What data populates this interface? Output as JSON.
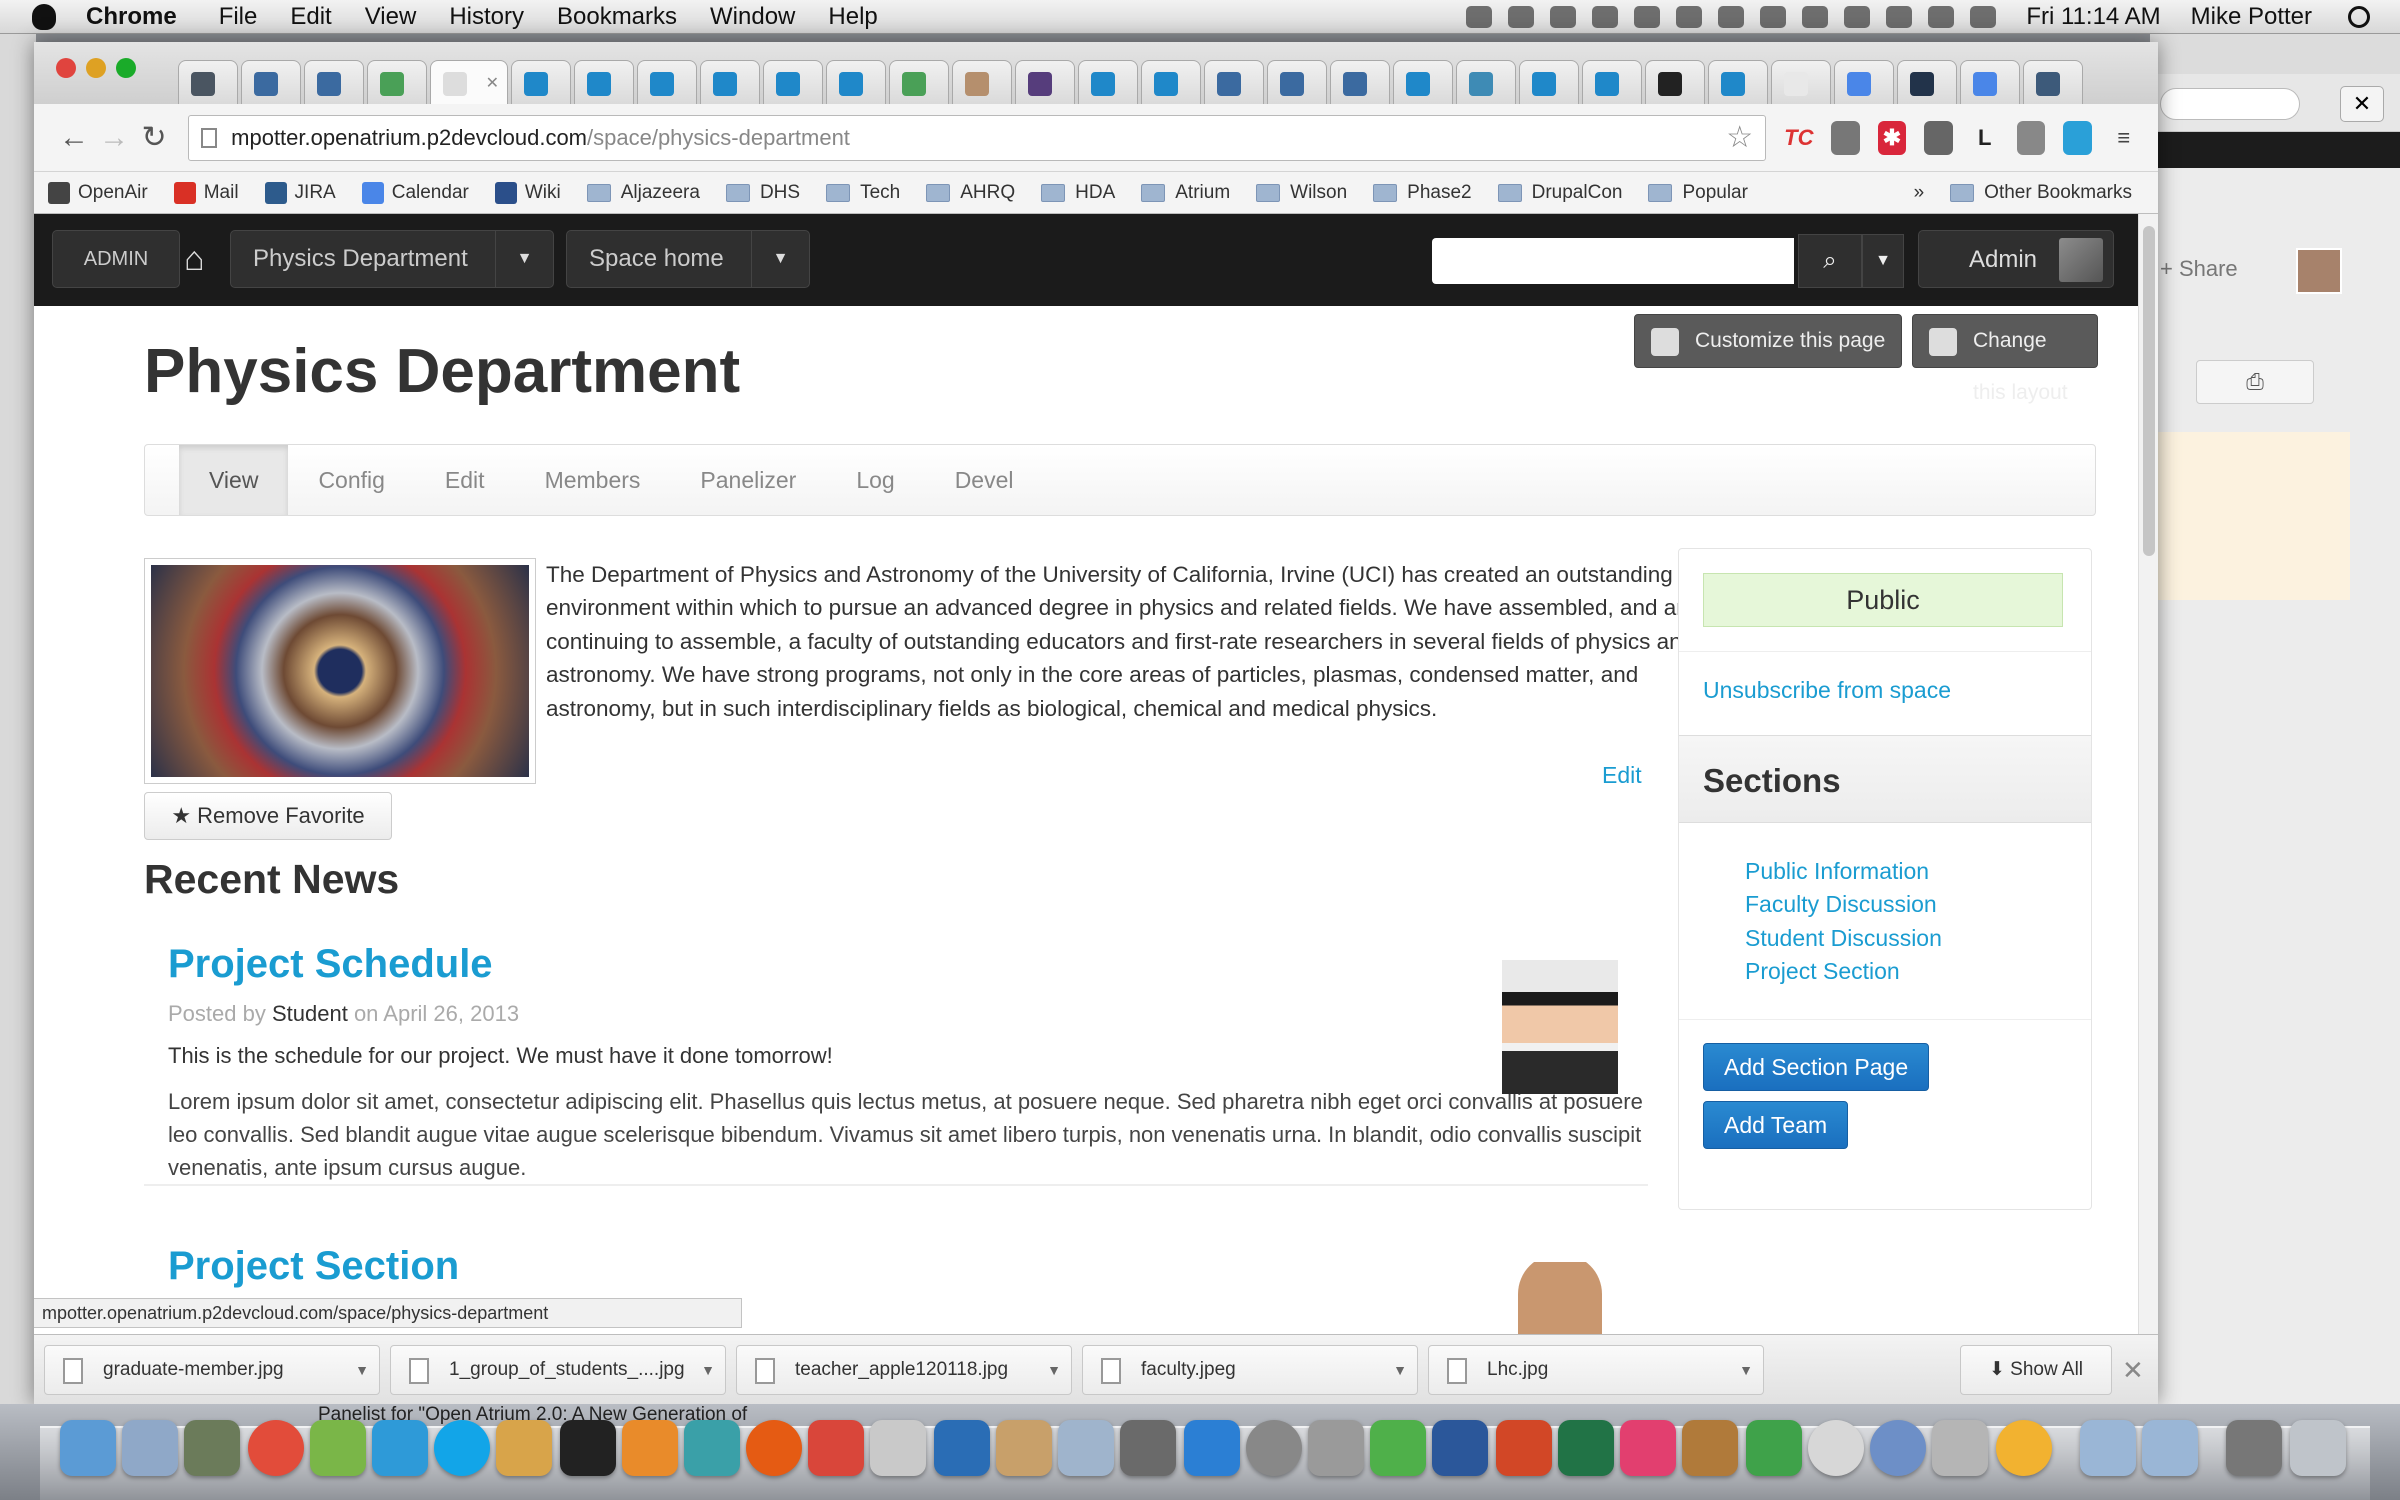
{
  "menubar": {
    "app": "Chrome",
    "items": [
      "File",
      "Edit",
      "View",
      "History",
      "Bookmarks",
      "Window",
      "Help"
    ],
    "clock": "Fri 11:14 AM",
    "user": "Mike Potter"
  },
  "browser": {
    "url_host": "mpotter.openatrium.p2devcloud.com",
    "url_path": "/space/physics-department",
    "bookmarks": [
      "OpenAir",
      "Mail",
      "JIRA",
      "Calendar",
      "Wiki",
      "Aljazeera",
      "DHS",
      "Tech",
      "AHRQ",
      "HDA",
      "Atrium",
      "Wilson",
      "Phase2",
      "DrupalCon",
      "Popular"
    ],
    "bookmarks_more": "»",
    "other_bookmarks": "Other Bookmarks",
    "status_url": "mpotter.openatrium.p2devcloud.com/space/physics-department"
  },
  "navbar": {
    "admin_label": "ADMIN",
    "space_label": "Physics Department",
    "space_home_label": "Space home",
    "user_label": "Admin"
  },
  "page": {
    "customize_label": "Customize this page",
    "change_layout_label": "Change this layout",
    "title": "Physics Department",
    "tabs": [
      "View",
      "Config",
      "Edit",
      "Members",
      "Panelizer",
      "Log",
      "Devel"
    ],
    "remove_favorite_label": "★ Remove Favorite",
    "description": "The Department of Physics and Astronomy of the University of California, Irvine (UCI) has created an outstanding environment within which to pursue an advanced degree in physics and related fields. We have assembled, and are continuing to assemble, a faculty of outstanding educators and first-rate researchers in several fields of physics and astronomy. We have strong programs, not only in the core areas of particles, plasmas, condensed matter, and astronomy, but in such interdisciplinary fields as biological, chemical and medical physics.",
    "edit_link": "Edit",
    "recent_news_title": "Recent News",
    "news": [
      {
        "title": "Project Schedule",
        "posted_by": "Posted by",
        "author": "Student",
        "date": "on April 26, 2013",
        "summary": "This is the schedule for our project.  We must have it done tomorrow!",
        "body": "Lorem ipsum dolor sit amet, consectetur adipiscing elit. Phasellus quis lectus metus, at posuere neque. Sed pharetra nibh eget orci convallis at posuere leo convallis. Sed blandit augue vitae augue scelerisque bibendum. Vivamus sit amet libero turpis, non venenatis urna. In blandit, odio convallis suscipit venenatis, ante ipsum cursus augue."
      },
      {
        "title": "Project Section"
      }
    ]
  },
  "sidebar": {
    "visibility": "Public",
    "unsubscribe": "Unsubscribe from space",
    "sections_title": "Sections",
    "sections": [
      "Public Information",
      "Faculty Discussion",
      "Student Discussion",
      "Project Section"
    ],
    "add_section_label": "Add Section Page",
    "add_team_label": "Add Team"
  },
  "downloads": {
    "files": [
      "graduate-member.jpg",
      "1_group_of_students_....jpg",
      "teacher_apple120118.jpg",
      "faculty.jpeg",
      "Lhc.jpg"
    ],
    "show_all": "Show All"
  },
  "background_window": {
    "share_label": "+ Share"
  },
  "dock": {
    "caption": "Panelist for \"Open Atrium 2.0: A New Generation of"
  },
  "colors": {
    "link": "#1a9cd1",
    "primary_button": "#1a6fbf",
    "navbar": "#1b1b1b",
    "public_badge": "#e6f7d9"
  }
}
